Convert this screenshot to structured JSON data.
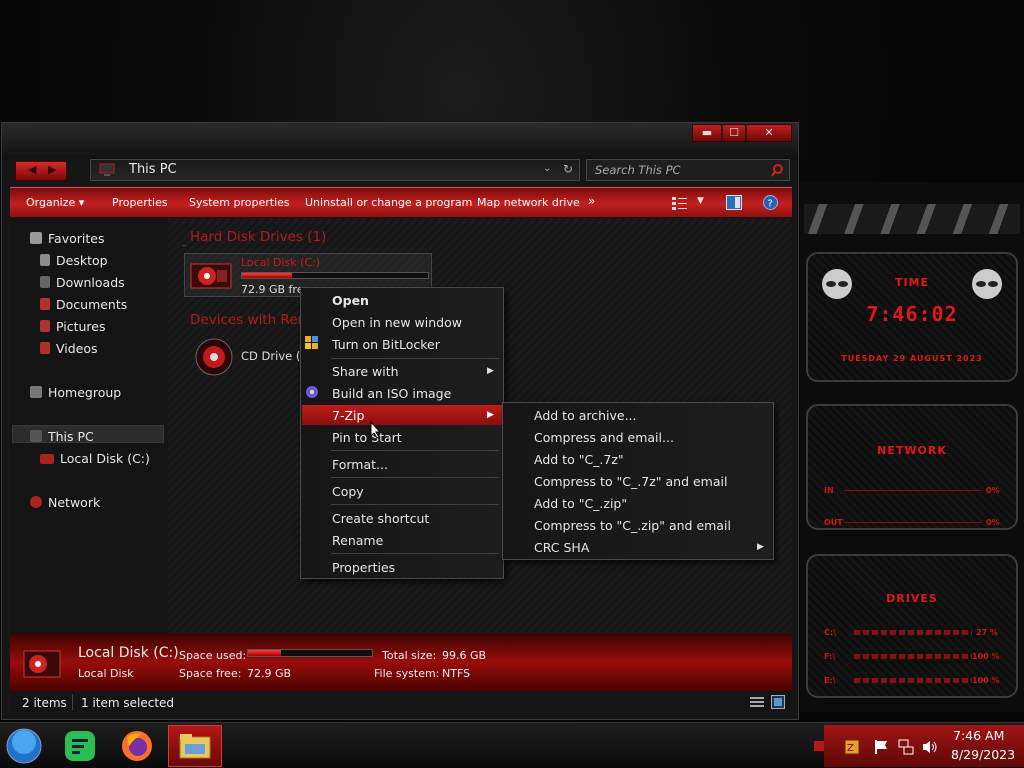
{
  "window": {
    "address": "This PC",
    "search_placeholder": "Search This PC",
    "caption_buttons": {
      "minimize": "▬",
      "maximize": "☐",
      "close": "✕"
    }
  },
  "toolbar": {
    "organize": "Organize ▾",
    "properties": "Properties",
    "system_properties": "System properties",
    "uninstall": "Uninstall or change a program",
    "map_drive": "Map network drive",
    "more": "»"
  },
  "navpane": {
    "favorites": "Favorites",
    "desktop": "Desktop",
    "downloads": "Downloads",
    "documents": "Documents",
    "pictures": "Pictures",
    "videos": "Videos",
    "homegroup": "Homegroup",
    "this_pc": "This PC",
    "local_disk": "Local Disk (C:)",
    "network": "Network"
  },
  "content": {
    "group_hdd": "Hard Disk Drives (1)",
    "group_removable": "Devices with Rem",
    "drive_c_name": "Local Disk (C:)",
    "drive_c_free": "72.9 GB free",
    "drive_c_used_fraction": 0.27,
    "cd_drive": "CD Drive (E:)"
  },
  "details": {
    "name": "Local Disk (C:)",
    "type": "Local Disk",
    "space_used_label": "Space used:",
    "space_free_label": "Space free:",
    "space_free": "72.9 GB",
    "total_size_label": "Total size:",
    "total_size": "99.6 GB",
    "file_system_label": "File system:",
    "file_system": "NTFS"
  },
  "status": {
    "items": "2 items",
    "selected": "1 item selected"
  },
  "context_menu": {
    "open": "Open",
    "open_new_window": "Open in new window",
    "bitlocker": "Turn on BitLocker",
    "share_with": "Share with",
    "build_iso": "Build an ISO image",
    "seven_zip": "7-Zip",
    "pin_start": "Pin to Start",
    "format": "Format...",
    "copy": "Copy",
    "create_shortcut": "Create shortcut",
    "rename": "Rename",
    "properties": "Properties"
  },
  "submenu_7zip": {
    "add_archive": "Add to archive...",
    "compress_email": "Compress and email...",
    "add_7z": "Add to \"C_.7z\"",
    "compress_7z_email": "Compress to \"C_.7z\" and email",
    "add_zip": "Add to \"C_.zip\"",
    "compress_zip_email": "Compress to \"C_.zip\" and email",
    "crc_sha": "CRC SHA"
  },
  "gadgets": {
    "time_title": "TIME",
    "time_value": "7:46:02",
    "date_value": "TUESDAY 29 AUGUST 2023",
    "network_title": "NETWORK",
    "in_label": "IN",
    "in_value": "0%",
    "out_label": "OUT",
    "out_value": "0%",
    "drives_title": "DRIVES",
    "drive1": "C:\\",
    "drive1_pct": "27 %",
    "drive2": "F:\\",
    "drive2_pct": "100 %",
    "drive3": "E:\\",
    "drive3_pct": "100 %"
  },
  "taskbar": {
    "time": "7:46 AM",
    "date": "8/29/2023"
  },
  "colors": {
    "accent": "#c41c1c",
    "dark": "#141414"
  }
}
